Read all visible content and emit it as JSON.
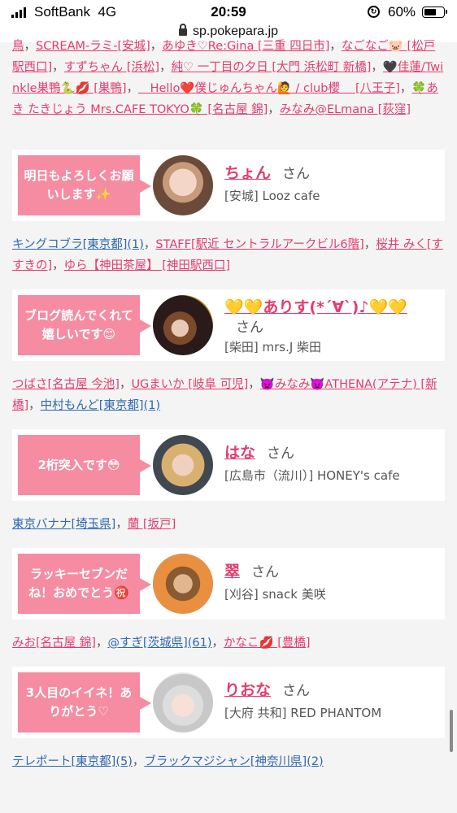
{
  "status": {
    "carrier": "SoftBank",
    "network": "4G",
    "time": "20:59",
    "battery": "60%",
    "battery_level": 0.6,
    "lock_glyph": "↻"
  },
  "url": "sp.pokepara.jp",
  "top_links": [
    {
      "text": "鳥",
      "color": "pink"
    },
    {
      "text": "SCREAM-ラミ-[安城]",
      "color": "pink"
    },
    {
      "text": "あゆき♡Re:Gina [三重 四日市]",
      "color": "pink"
    },
    {
      "text": "なごなご🐷 [松戸駅西口]",
      "color": "pink"
    },
    {
      "text": "すずちゃん [浜松]",
      "color": "pink"
    },
    {
      "text": "純♡ 一丁目の夕日 [大門 浜松町 新橋]",
      "color": "pink"
    },
    {
      "text": "🖤佳蓮/Twinkle巣鴨🐍💋 [巣鴨]",
      "color": "pink"
    },
    {
      "text": "＿Hello❤️僕じゅんちゃん🙋 / club櫻＿ [八王子]",
      "color": "pink"
    },
    {
      "text": "🍀あき たきじょう Mrs.CAFE TOKYO🍀 [名古屋 錦]",
      "color": "pink"
    },
    {
      "text": "みなみ@ELmana [荻窪]",
      "color": "pink"
    }
  ],
  "cards": [
    {
      "bubble": "明日もよろしくお願いします✨",
      "name": "ちょん",
      "san": "さん",
      "shop": "[安城] Looz cafe",
      "links": [
        {
          "text": "キングコブラ[東京都](1)",
          "color": "blue"
        },
        {
          "text": "STAFF[駅近 セントラルアークビル6階]",
          "color": "pink"
        },
        {
          "text": "桜井 みく[すすきの]",
          "color": "pink"
        },
        {
          "text": "ゆら【神田茶屋】 [神田駅西口]",
          "color": "pink"
        }
      ]
    },
    {
      "bubble": "ブログ読んでくれて嬉しいです😊",
      "name": "💛💛ありす(*´∀`)♪💛💛",
      "san": "さん",
      "shop": "[柴田] mrs.J 柴田",
      "links": [
        {
          "text": "つばさ[名古屋 今池]",
          "color": "pink"
        },
        {
          "text": "UGまいか [岐阜 可児]",
          "color": "pink"
        },
        {
          "text": "👿みなみ👿ATHENA(アテナ) [新橋]",
          "color": "pink"
        },
        {
          "text": "中村もんど[東京都](1)",
          "color": "blue"
        }
      ]
    },
    {
      "bubble": "2桁突入です😳",
      "name": "はな",
      "san": "さん",
      "shop": "[広島市（流川）] HONEY's cafe",
      "links": [
        {
          "text": "東京バナナ[埼玉県]",
          "color": "blue"
        },
        {
          "text": "蘭 [坂戸]",
          "color": "pink"
        }
      ]
    },
    {
      "bubble": "ラッキーセブンだね！おめでとう㊗️",
      "name": "翠",
      "san": "さん",
      "shop": "[刈谷] snack 美咲",
      "links": [
        {
          "text": "みお[名古屋 錦]",
          "color": "pink"
        },
        {
          "text": "@すぎ[茨城県](61)",
          "color": "blue"
        },
        {
          "text": "かなこ💋 [豊橋]",
          "color": "pink"
        }
      ]
    },
    {
      "bubble": "3人目のイイネ！ありがとう♡",
      "name": "りおな",
      "san": "さん",
      "shop": "[大府 共和] RED PHANTOM",
      "links": [
        {
          "text": "テレポート[東京都](5)",
          "color": "blue"
        },
        {
          "text": "ブラックマジシャン[神奈川県](2)",
          "color": "blue"
        }
      ]
    }
  ],
  "separator": "，",
  "colors": {
    "pink": "#e23d6d",
    "blue": "#2e68b0",
    "bubble": "#f58ca2"
  }
}
